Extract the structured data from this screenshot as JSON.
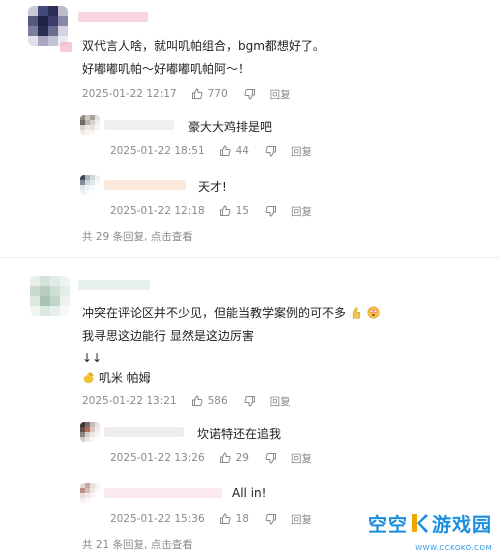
{
  "comments": [
    {
      "lines": [
        "双代言人啥，就叫叽帕组合，bgm都想好了。",
        "好嘟嘟叽帕～好嘟嘟叽帕阿～！"
      ],
      "date": "2025-01-22 12:17",
      "likes": "770",
      "reply_label": "回复",
      "replies": [
        {
          "text": "豪大大鸡排是吧",
          "date": "2025-01-22 18:51",
          "likes": "44",
          "reply_label": "回复"
        },
        {
          "text": "天才!",
          "date": "2025-01-22 12:18",
          "likes": "15",
          "reply_label": "回复"
        }
      ],
      "more": {
        "count_text": "共 29 条回复,",
        "link": "点击查看"
      }
    },
    {
      "lines": [
        "冲突在评论区并不少见，但能当教学案例的可不多",
        "我寻思这边能行 显然是这边厉害",
        "↓↓",
        "叽米  帕姆"
      ],
      "date": "2025-01-22 13:21",
      "likes": "586",
      "reply_label": "回复",
      "replies": [
        {
          "text": "坎诺特还在追我",
          "date": "2025-01-22 13:26",
          "likes": "29",
          "reply_label": "回复"
        },
        {
          "text": "All in!",
          "date": "2025-01-22 15:36",
          "likes": "18",
          "reply_label": "回复"
        }
      ],
      "more": {
        "count_text": "共 21 条回复,",
        "link": "点击查看"
      }
    }
  ],
  "watermark": {
    "main_left": "空空",
    "main_right": "游戏园",
    "sub": "WWW.CCKOKO.COM"
  },
  "colors": {
    "meta": "#8a8a8a",
    "text": "#222222",
    "divider": "#ececec",
    "watermark": "#1a8fe0"
  }
}
